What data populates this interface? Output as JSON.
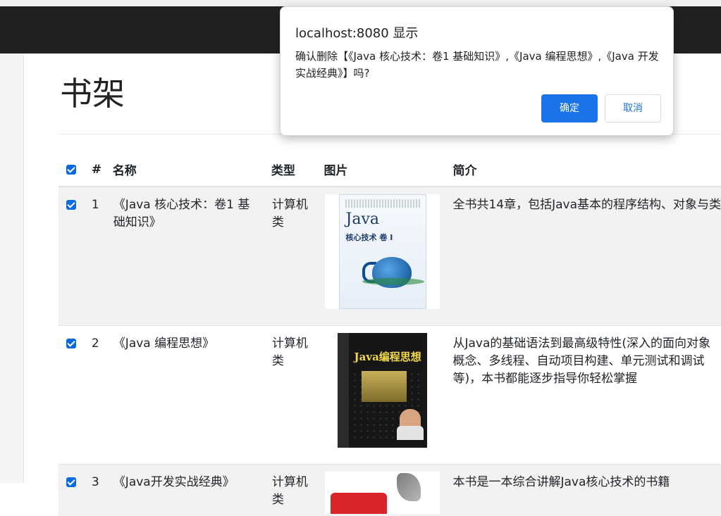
{
  "page": {
    "title": "书架"
  },
  "table": {
    "headers": {
      "num": "#",
      "name": "名称",
      "type": "类型",
      "image": "图片",
      "description": "简介"
    },
    "rows": [
      {
        "num": "1",
        "name": "《Java 核心技术：卷1 基础知识》",
        "type": "计算机类",
        "description": "全书共14章，包括Java基本的程序结构、对象与类",
        "checked": true,
        "cover_icon": "java-core-book-cover"
      },
      {
        "num": "2",
        "name": "《Java 编程思想》",
        "type": "计算机类",
        "description": "从Java的基础语法到最高级特性(深入的面向对象概念、多线程、自动项目构建、单元测试和调试等)，本书都能逐步指导你轻松掌握",
        "checked": true,
        "cover_icon": "thinking-in-java-book-cover"
      },
      {
        "num": "3",
        "name": "《Java开发实战经典》",
        "type": "计算机类",
        "description": "本书是一本综合讲解Java核心技术的书籍",
        "checked": true,
        "cover_icon": "java-practice-book-cover"
      }
    ],
    "select_all_checked": true
  },
  "dialog": {
    "title": "localhost:8080 显示",
    "message": "确认删除【《Java 核心技术：卷1 基础知识》,《Java 编程思想》,《Java 开发实战经典》】吗?",
    "ok_label": "确定",
    "cancel_label": "取消"
  },
  "colors": {
    "accent": "#1a73e8",
    "checkbox": "#0b6bde",
    "navbar": "#212121"
  }
}
